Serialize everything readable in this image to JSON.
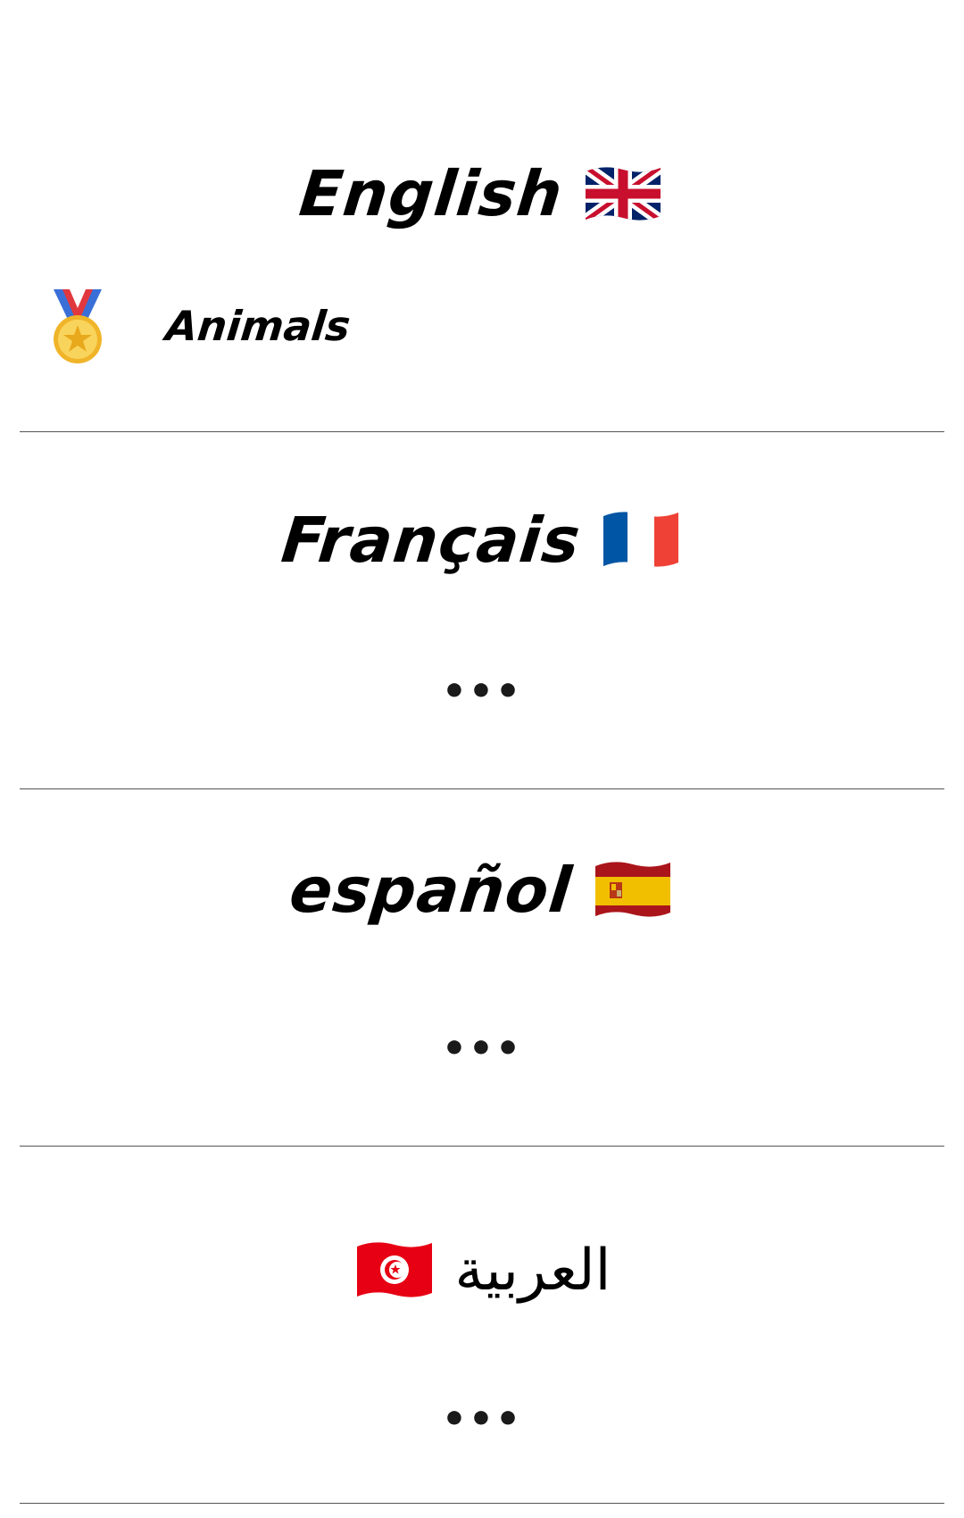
{
  "sections": [
    {
      "title": "English",
      "flag_icon": "uk-flag-icon",
      "items": [
        {
          "label": "Animals",
          "icon": "medal-icon"
        }
      ]
    },
    {
      "title": "Français",
      "flag_icon": "france-flag-icon",
      "more": "•••"
    },
    {
      "title": "español",
      "flag_icon": "spain-flag-icon",
      "more": "•••"
    },
    {
      "title": "العربية",
      "flag_icon": "tunisia-flag-icon",
      "more": "•••"
    }
  ],
  "colors": {
    "divider": "#555555",
    "text": "#000000",
    "uk_blue": "#012169",
    "uk_red": "#C8102E",
    "france_blue": "#0055A4",
    "france_red": "#EF4135",
    "spain_red": "#AA151B",
    "spain_yellow": "#F1BF00",
    "tunisia_red": "#E70013",
    "medal_gold": "#F5C542",
    "medal_ribbon_blue": "#3A6FD8",
    "medal_ribbon_red": "#E0383E"
  }
}
